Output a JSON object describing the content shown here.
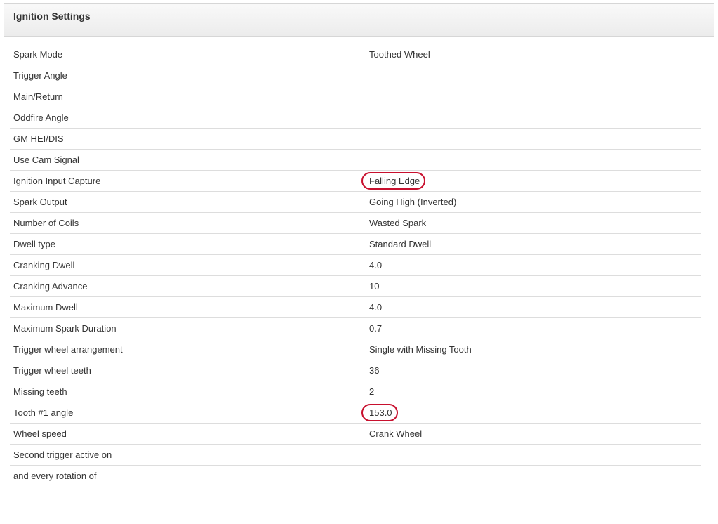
{
  "panel": {
    "title": "Ignition Settings"
  },
  "rows": [
    {
      "label": "Spark Mode",
      "value": "Toothed Wheel"
    },
    {
      "label": "Trigger Angle",
      "value": ""
    },
    {
      "label": "Main/Return",
      "value": ""
    },
    {
      "label": "Oddfire Angle",
      "value": ""
    },
    {
      "label": "GM HEI/DIS",
      "value": ""
    },
    {
      "label": "Use Cam Signal",
      "value": ""
    },
    {
      "label": "Ignition Input Capture",
      "value": "Falling Edge"
    },
    {
      "label": "Spark Output",
      "value": "Going High (Inverted)"
    },
    {
      "label": "Number of Coils",
      "value": "Wasted Spark"
    },
    {
      "label": "Dwell type",
      "value": "Standard Dwell"
    },
    {
      "label": "Cranking Dwell",
      "value": "4.0"
    },
    {
      "label": "Cranking Advance",
      "value": "10"
    },
    {
      "label": "Maximum Dwell",
      "value": "4.0"
    },
    {
      "label": "Maximum Spark Duration",
      "value": "0.7"
    },
    {
      "label": "Trigger wheel arrangement",
      "value": "Single with Missing Tooth"
    },
    {
      "label": "Trigger wheel teeth",
      "value": "36"
    },
    {
      "label": "Missing teeth",
      "value": "2"
    },
    {
      "label": "Tooth #1 angle",
      "value": "153.0"
    },
    {
      "label": "Wheel speed",
      "value": "Crank Wheel"
    },
    {
      "label": "Second trigger active on",
      "value": ""
    },
    {
      "label": "and every rotation of",
      "value": ""
    }
  ],
  "annotation_color": "#c8102e"
}
